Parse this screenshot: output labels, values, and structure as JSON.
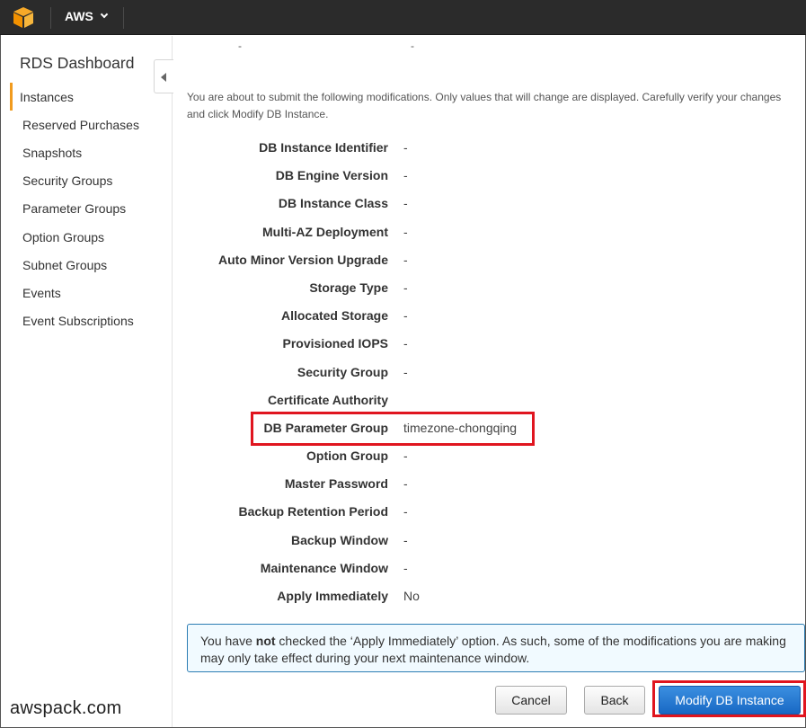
{
  "topbar": {
    "menu_label": "AWS",
    "logo_icon": "aws-cube-icon"
  },
  "sidebar": {
    "title": "RDS Dashboard",
    "items": [
      {
        "label": "Instances",
        "active": true
      },
      {
        "label": "Reserved Purchases"
      },
      {
        "label": "Snapshots"
      },
      {
        "label": "Security Groups"
      },
      {
        "label": "Parameter Groups"
      },
      {
        "label": "Option Groups"
      },
      {
        "label": "Subnet Groups"
      },
      {
        "label": "Events"
      },
      {
        "label": "Event Subscriptions"
      }
    ],
    "watermark": "awspack.com"
  },
  "main": {
    "intro": "You are about to submit the following modifications. Only values that will change are displayed. Carefully verify your changes and click Modify DB Instance.",
    "top_fragment_a": "-",
    "top_fragment_b": "-",
    "rows": [
      {
        "label": "DB Instance Identifier",
        "value": "-"
      },
      {
        "label": "DB Engine Version",
        "value": "-"
      },
      {
        "label": "DB Instance Class",
        "value": "-"
      },
      {
        "label": "Multi-AZ Deployment",
        "value": "-"
      },
      {
        "label": "Auto Minor Version Upgrade",
        "value": "-"
      },
      {
        "label": "Storage Type",
        "value": "-"
      },
      {
        "label": "Allocated Storage",
        "value": "-"
      },
      {
        "label": "Provisioned IOPS",
        "value": "-"
      },
      {
        "label": "Security Group",
        "value": "-"
      },
      {
        "label": "Certificate Authority",
        "value": ""
      },
      {
        "label": "DB Parameter Group",
        "value": "timezone-chongqing"
      },
      {
        "label": "Option Group",
        "value": "-"
      },
      {
        "label": "Master Password",
        "value": "-"
      },
      {
        "label": "Backup Retention Period",
        "value": "-"
      },
      {
        "label": "Backup Window",
        "value": "-"
      },
      {
        "label": "Maintenance Window",
        "value": "-"
      },
      {
        "label": "Apply Immediately",
        "value": "No"
      }
    ],
    "info": {
      "before": "You have ",
      "emphasis": "not",
      "after": " checked the ‘Apply Immediately’ option. As such, some of the modifications you are making may only take effect during your next maintenance window."
    },
    "buttons": {
      "cancel": "Cancel",
      "back": "Back",
      "modify": "Modify DB Instance"
    }
  },
  "colors": {
    "topbar": "#2b2b2b",
    "active_accent": "#f19b1e",
    "highlight": "#e0151f",
    "primary_button": "#1f72cf",
    "info_border": "#2c7db3"
  }
}
